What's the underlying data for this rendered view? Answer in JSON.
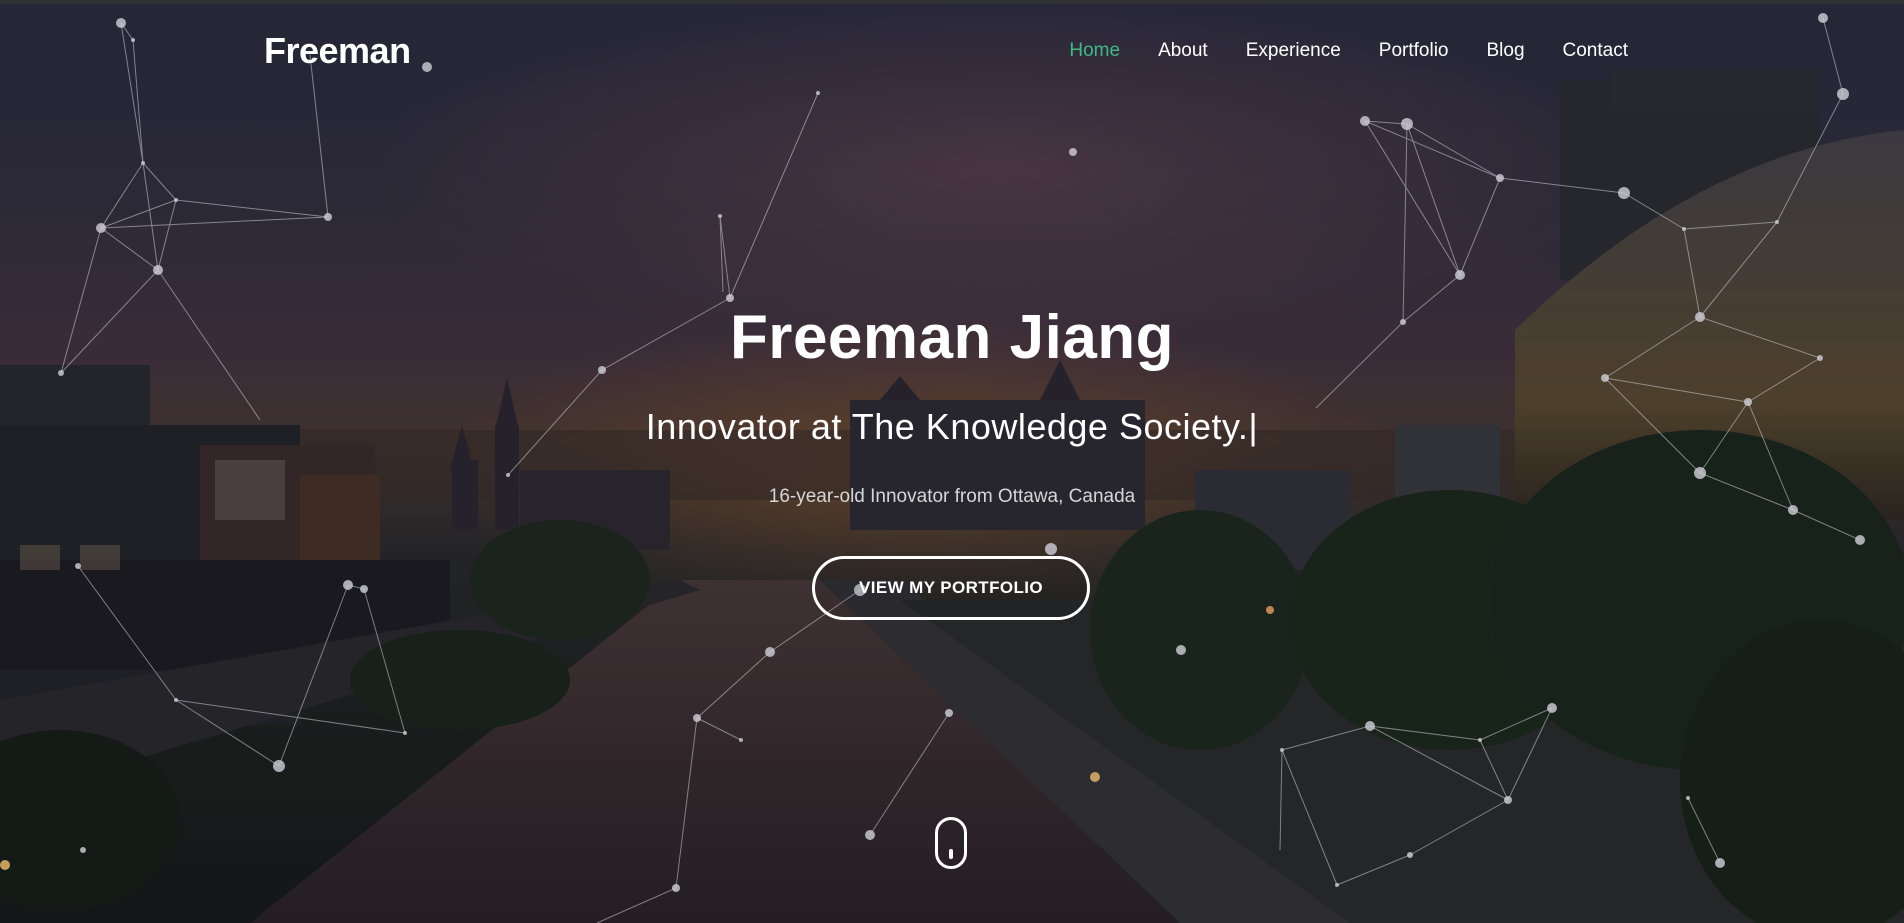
{
  "navbar": {
    "brand": "Freeman",
    "links": [
      "Home",
      "About",
      "Experience",
      "Portfolio",
      "Blog",
      "Contact"
    ],
    "active": "Home",
    "active_color": "#41b883"
  },
  "hero": {
    "title": "Freeman Jiang",
    "subtitle": "Innovator at The Knowledge Society.",
    "typing_cursor": "|",
    "tagline": "16-year-old Innovator from Ottawa, Canada",
    "cta_label": "VIEW MY PORTFOLIO",
    "scroll_indicator": "mouse-scroll-icon"
  },
  "colors": {
    "text": "#ffffff",
    "accent": "#41b883",
    "tagline": "#d6d6d6"
  }
}
